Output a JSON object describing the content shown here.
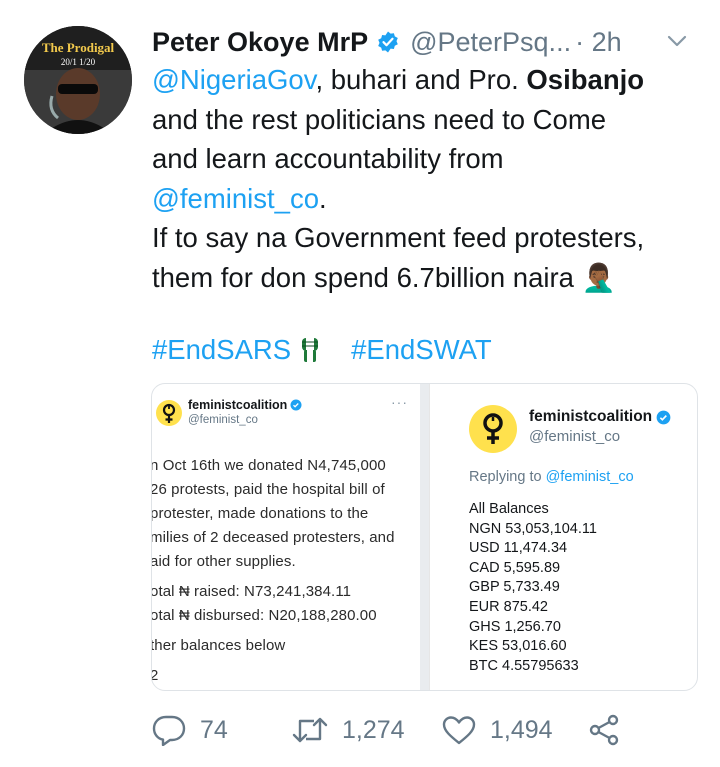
{
  "avatar": {
    "title": "The Prodigal",
    "date": "20/1 1/20"
  },
  "author": {
    "name": "Peter Okoye MrP",
    "handle": "@PeterPsq...",
    "time": "· 2h"
  },
  "tweet": {
    "mention1": "@NigeriaGov",
    "text1": ", buhari and Pro. ",
    "bold1": "Osibanjo",
    "line2": "and the rest politicians need to Come",
    "line3": "and learn accountability from",
    "mention2": "@feminist_co",
    "dot": ".",
    "line5": "If to say na Government feed protesters,",
    "line6": "them for don spend 6.7billion naira",
    "emoji": "🤦🏾‍♂️"
  },
  "hashtags": [
    "#EndSARS",
    "#EndSWAT"
  ],
  "media": {
    "left": {
      "name": "feministcoalition",
      "handle": "@feminist_co",
      "dots": "···",
      "lines": [
        "n Oct 16th we donated N4,745,000",
        "26 protests, paid the hospital bill of",
        "protester, made donations to the",
        "milies of 2 deceased protesters, and",
        "aid for other supplies.",
        "",
        "otal ₦ raised: N73,241,384.11",
        "otal ₦ disbursed: N20,188,280.00",
        "",
        "ther balances below",
        "",
        "2"
      ]
    },
    "right": {
      "name": "feministcoalition",
      "handle": "@feminist_co",
      "reply_prefix": "Replying to ",
      "reply_handle": "@feminist_co",
      "balances": [
        "All Balances",
        "NGN 53,053,104.11",
        "USD 11,474.34",
        "CAD 5,595.89",
        "GBP 5,733.49",
        "EUR 875.42",
        "GHS 1,256.70",
        "KES  53,016.60",
        "BTC 4.55795633"
      ]
    }
  },
  "actions": {
    "replies": "74",
    "retweets": "1,274",
    "likes": "1,494"
  },
  "colors": {
    "link": "#1da1f2",
    "muted": "#657786",
    "verified": "#1da1f2",
    "logo_yellow": "#ffe14d"
  }
}
